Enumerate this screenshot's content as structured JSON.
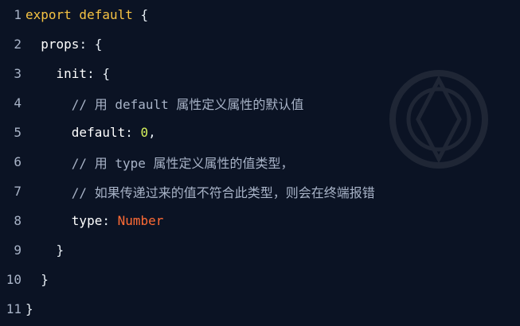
{
  "editor": {
    "lines": [
      {
        "number": "1",
        "indent": "",
        "parts": [
          {
            "text": "export default",
            "type": "kw"
          },
          {
            "text": " {",
            "type": "punct"
          }
        ]
      },
      {
        "number": "2",
        "indent": "  ",
        "parts": [
          {
            "text": "props",
            "type": "name"
          },
          {
            "text": ": {",
            "type": "punct"
          }
        ]
      },
      {
        "number": "3",
        "indent": "    ",
        "parts": [
          {
            "text": "init",
            "type": "name"
          },
          {
            "text": ": {",
            "type": "punct"
          }
        ]
      },
      {
        "number": "4",
        "indent": "      ",
        "parts": [
          {
            "text": "// 用 default 属性定义属性的默认值",
            "type": "comment"
          }
        ]
      },
      {
        "number": "5",
        "indent": "      ",
        "parts": [
          {
            "text": "default",
            "type": "name"
          },
          {
            "text": ": ",
            "type": "punct"
          },
          {
            "text": "0",
            "type": "num"
          },
          {
            "text": ",",
            "type": "punct"
          }
        ]
      },
      {
        "number": "6",
        "indent": "      ",
        "parts": [
          {
            "text": "// 用 type 属性定义属性的值类型，",
            "type": "comment"
          }
        ]
      },
      {
        "number": "7",
        "indent": "      ",
        "parts": [
          {
            "text": "// 如果传递过来的值不符合此类型，则会在终端报错",
            "type": "comment"
          }
        ]
      },
      {
        "number": "8",
        "indent": "      ",
        "parts": [
          {
            "text": "type",
            "type": "name"
          },
          {
            "text": ": ",
            "type": "punct"
          },
          {
            "text": "Number",
            "type": "type"
          }
        ]
      },
      {
        "number": "9",
        "indent": "    ",
        "parts": [
          {
            "text": "}",
            "type": "punct"
          }
        ]
      },
      {
        "number": "10",
        "indent": "  ",
        "parts": [
          {
            "text": "}",
            "type": "punct"
          }
        ]
      },
      {
        "number": "11",
        "indent": "",
        "parts": [
          {
            "text": "}",
            "type": "punct"
          }
        ]
      }
    ]
  }
}
